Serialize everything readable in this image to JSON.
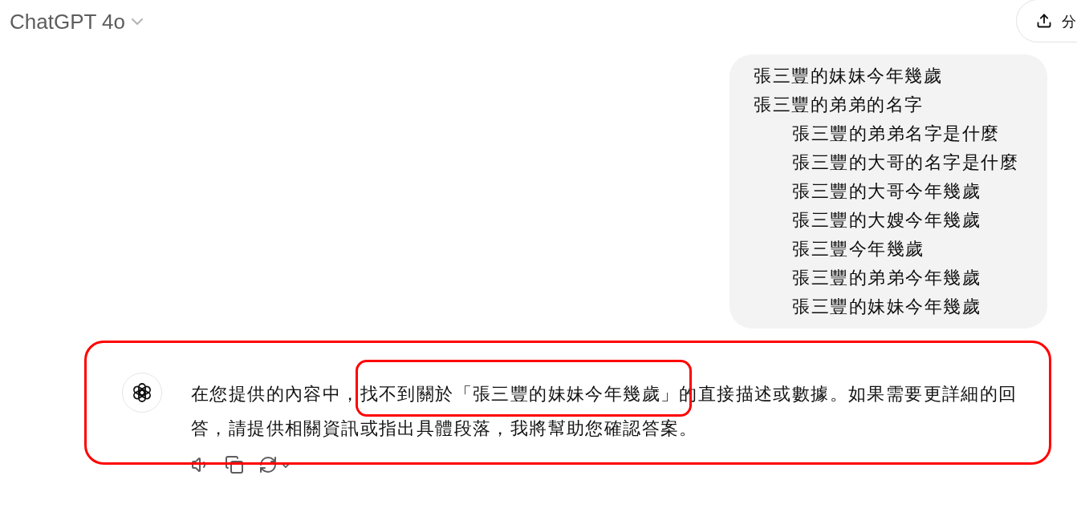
{
  "header": {
    "title": "ChatGPT 4o",
    "share_button": "分"
  },
  "user_message": {
    "lines": [
      {
        "text": "張三豐的妹妹今年幾歲"
      },
      {
        "text": "張三豐的弟弟的名字",
        "children": [
          {
            "text": "張三豐的弟弟名字是什麼"
          },
          {
            "text": "張三豐的大哥的名字是什麼"
          },
          {
            "text": "張三豐的大哥今年幾歲"
          },
          {
            "text": "張三豐的大嫂今年幾歲"
          },
          {
            "text": "張三豐今年幾歲"
          },
          {
            "text": "張三豐的弟弟今年幾歲"
          },
          {
            "text": "張三豐的妹妹今年幾歲"
          }
        ]
      }
    ]
  },
  "assistant_message": {
    "text": "在您提供的內容中，找不到關於「張三豐的妹妹今年幾歲」的直接描述或數據。如果需要更詳細的回答，請提供相關資訊或指出具體段落，我將幫助您確認答案。"
  },
  "annotations": {
    "message_frame": true,
    "phrase_frame": true
  }
}
